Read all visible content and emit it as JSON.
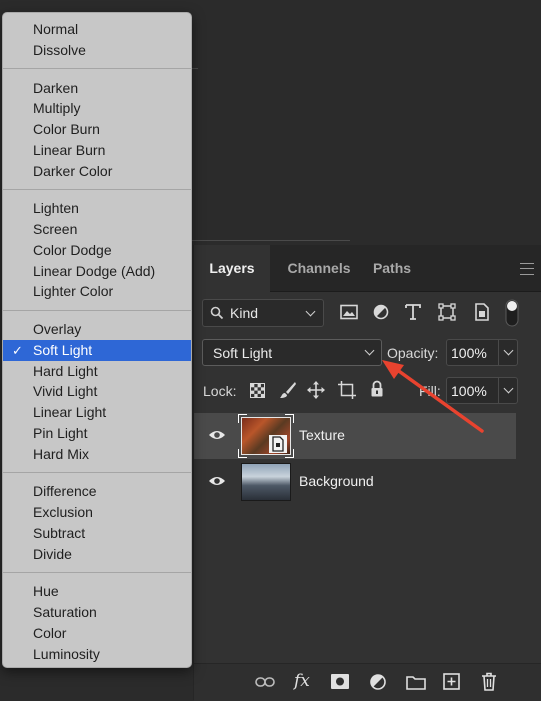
{
  "blend_menu": {
    "groups": [
      [
        "Normal",
        "Dissolve"
      ],
      [
        "Darken",
        "Multiply",
        "Color Burn",
        "Linear Burn",
        "Darker Color"
      ],
      [
        "Lighten",
        "Screen",
        "Color Dodge",
        "Linear Dodge (Add)",
        "Lighter Color"
      ],
      [
        "Overlay",
        "Soft Light",
        "Hard Light",
        "Vivid Light",
        "Linear Light",
        "Pin Light",
        "Hard Mix"
      ],
      [
        "Difference",
        "Exclusion",
        "Subtract",
        "Divide"
      ],
      [
        "Hue",
        "Saturation",
        "Color",
        "Luminosity"
      ]
    ],
    "selected": "Soft Light",
    "check_glyph": "✓",
    "selected_color": "#2e67d6"
  },
  "panel": {
    "tabs": [
      "Layers",
      "Channels",
      "Paths"
    ],
    "active_tab": "Layers",
    "filter": {
      "label": "Kind",
      "icons": [
        "image-filter-icon",
        "adjustment-filter-icon",
        "type-filter-icon",
        "shape-filter-icon",
        "smart-object-filter-icon",
        "filter-toggle-icon"
      ]
    },
    "blend_mode": "Soft Light",
    "opacity_label": "Opacity:",
    "opacity_value": "100%",
    "lock_label": "Lock:",
    "lock_icons": [
      "lock-transparent-pixels-icon",
      "lock-image-pixels-icon",
      "lock-position-icon",
      "lock-artboard-icon",
      "lock-all-icon"
    ],
    "fill_label": "Fill:",
    "fill_value": "100%",
    "layers": [
      {
        "name": "Texture",
        "selected": true,
        "visible": true,
        "smart_object": true
      },
      {
        "name": "Background",
        "selected": false,
        "visible": true,
        "smart_object": false
      }
    ],
    "bottom_icons": [
      "link-layers-icon",
      "fx-icon",
      "add-mask-icon",
      "adjustment-layer-icon",
      "new-group-icon",
      "new-layer-icon",
      "delete-layer-icon"
    ],
    "fx_label": "fx"
  },
  "annotation": {
    "arrow_color": "#e8432f"
  }
}
